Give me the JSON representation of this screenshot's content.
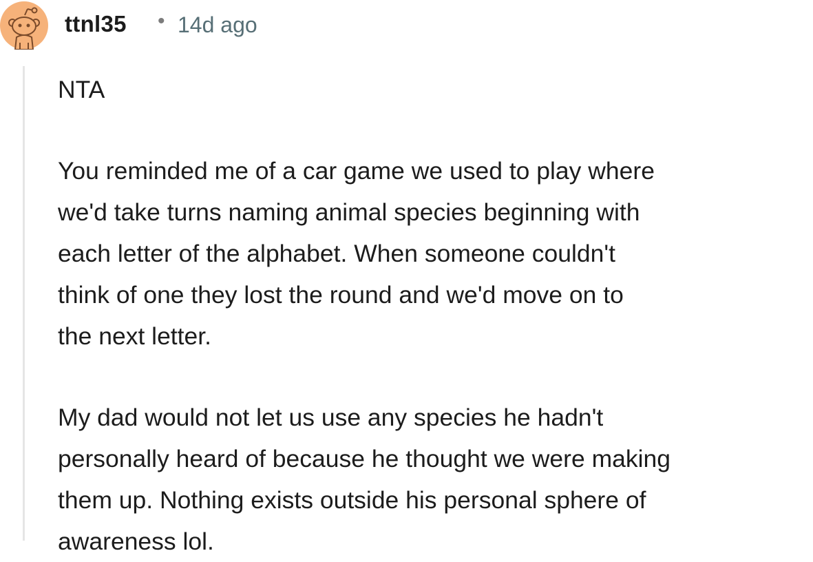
{
  "comment": {
    "author": {
      "username": "ttnl35",
      "avatar_icon": "reddit-snoo-avatar-icon",
      "avatar_color": "#f6b27a"
    },
    "separator": "•",
    "timestamp": "14d ago",
    "body": {
      "paragraphs": [
        "NTA",
        "You reminded me of a car game we used to play where\nwe'd take turns naming animal species beginning with\neach letter of the alphabet. When someone couldn't\nthink of one they lost the round and we'd move on to\nthe next letter.",
        "My dad would not let us use any species he hadn't\npersonally heard of because he thought we were making\nthem up. Nothing exists outside his personal sphere of\nawareness lol."
      ]
    }
  }
}
